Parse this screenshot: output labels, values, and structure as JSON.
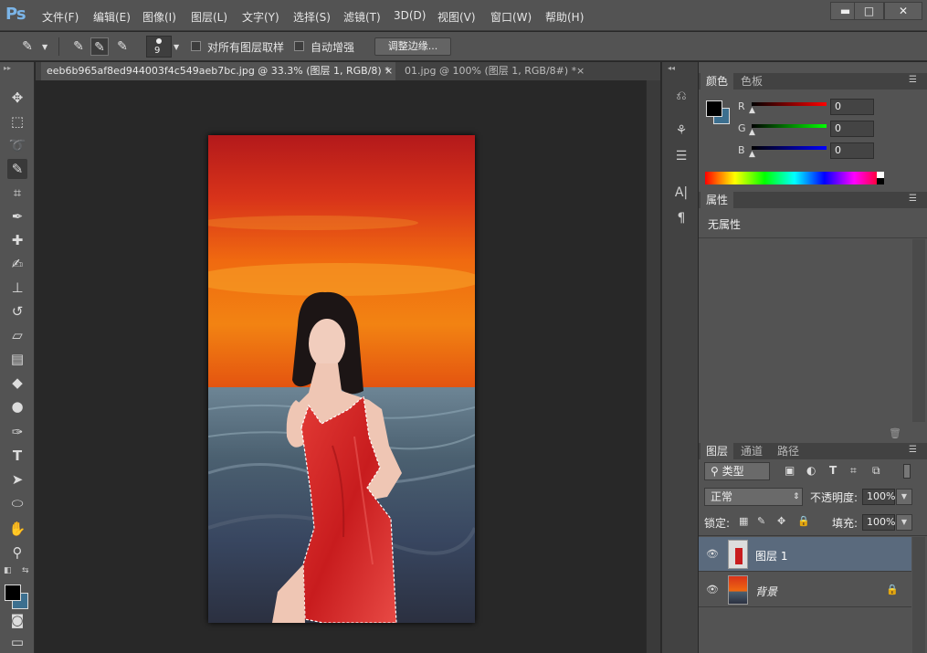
{
  "app": {
    "logo": "Ps"
  },
  "menu": [
    "文件(F)",
    "编辑(E)",
    "图像(I)",
    "图层(L)",
    "文字(Y)",
    "选择(S)",
    "滤镜(T)",
    "3D(D)",
    "视图(V)",
    "窗口(W)",
    "帮助(H)"
  ],
  "window_controls": {
    "minimize": "▬",
    "maximize": "□",
    "close": "✕"
  },
  "options": {
    "brush_size": "9",
    "sample_all_layers": "对所有图层取样",
    "auto_enhance": "自动增强",
    "refine_edge": "调整边缘..."
  },
  "tabs": [
    {
      "label": "eeb6b965af8ed944003f4c549aeb7bc.jpg @ 33.3% (图层 1, RGB/8) *",
      "close": "×"
    },
    {
      "label": "01.jpg @ 100% (图层 1, RGB/8#) *",
      "close": "×"
    }
  ],
  "color_panel": {
    "tabs": [
      "颜色",
      "色板"
    ],
    "channels": [
      {
        "label": "R",
        "value": "0"
      },
      {
        "label": "G",
        "value": "0"
      },
      {
        "label": "B",
        "value": "0"
      }
    ],
    "foreground": "#000000",
    "background": "#3c6f8f"
  },
  "properties_panel": {
    "tab": "属性",
    "empty_text": "无属性"
  },
  "layers_panel": {
    "tabs": [
      "图层",
      "通道",
      "路径"
    ],
    "filter_kind": "类型",
    "blend_mode": "正常",
    "opacity_label": "不透明度:",
    "opacity_value": "100%",
    "lock_label": "锁定:",
    "fill_label": "填充:",
    "fill_value": "100%",
    "layers": [
      {
        "name": "图层 1",
        "selected": true,
        "visible": true,
        "locked": false
      },
      {
        "name": "背景",
        "selected": false,
        "visible": true,
        "locked": true
      }
    ]
  },
  "colors": {
    "accent": "#7bb5e8",
    "selected_layer": "#5a6a7d"
  }
}
